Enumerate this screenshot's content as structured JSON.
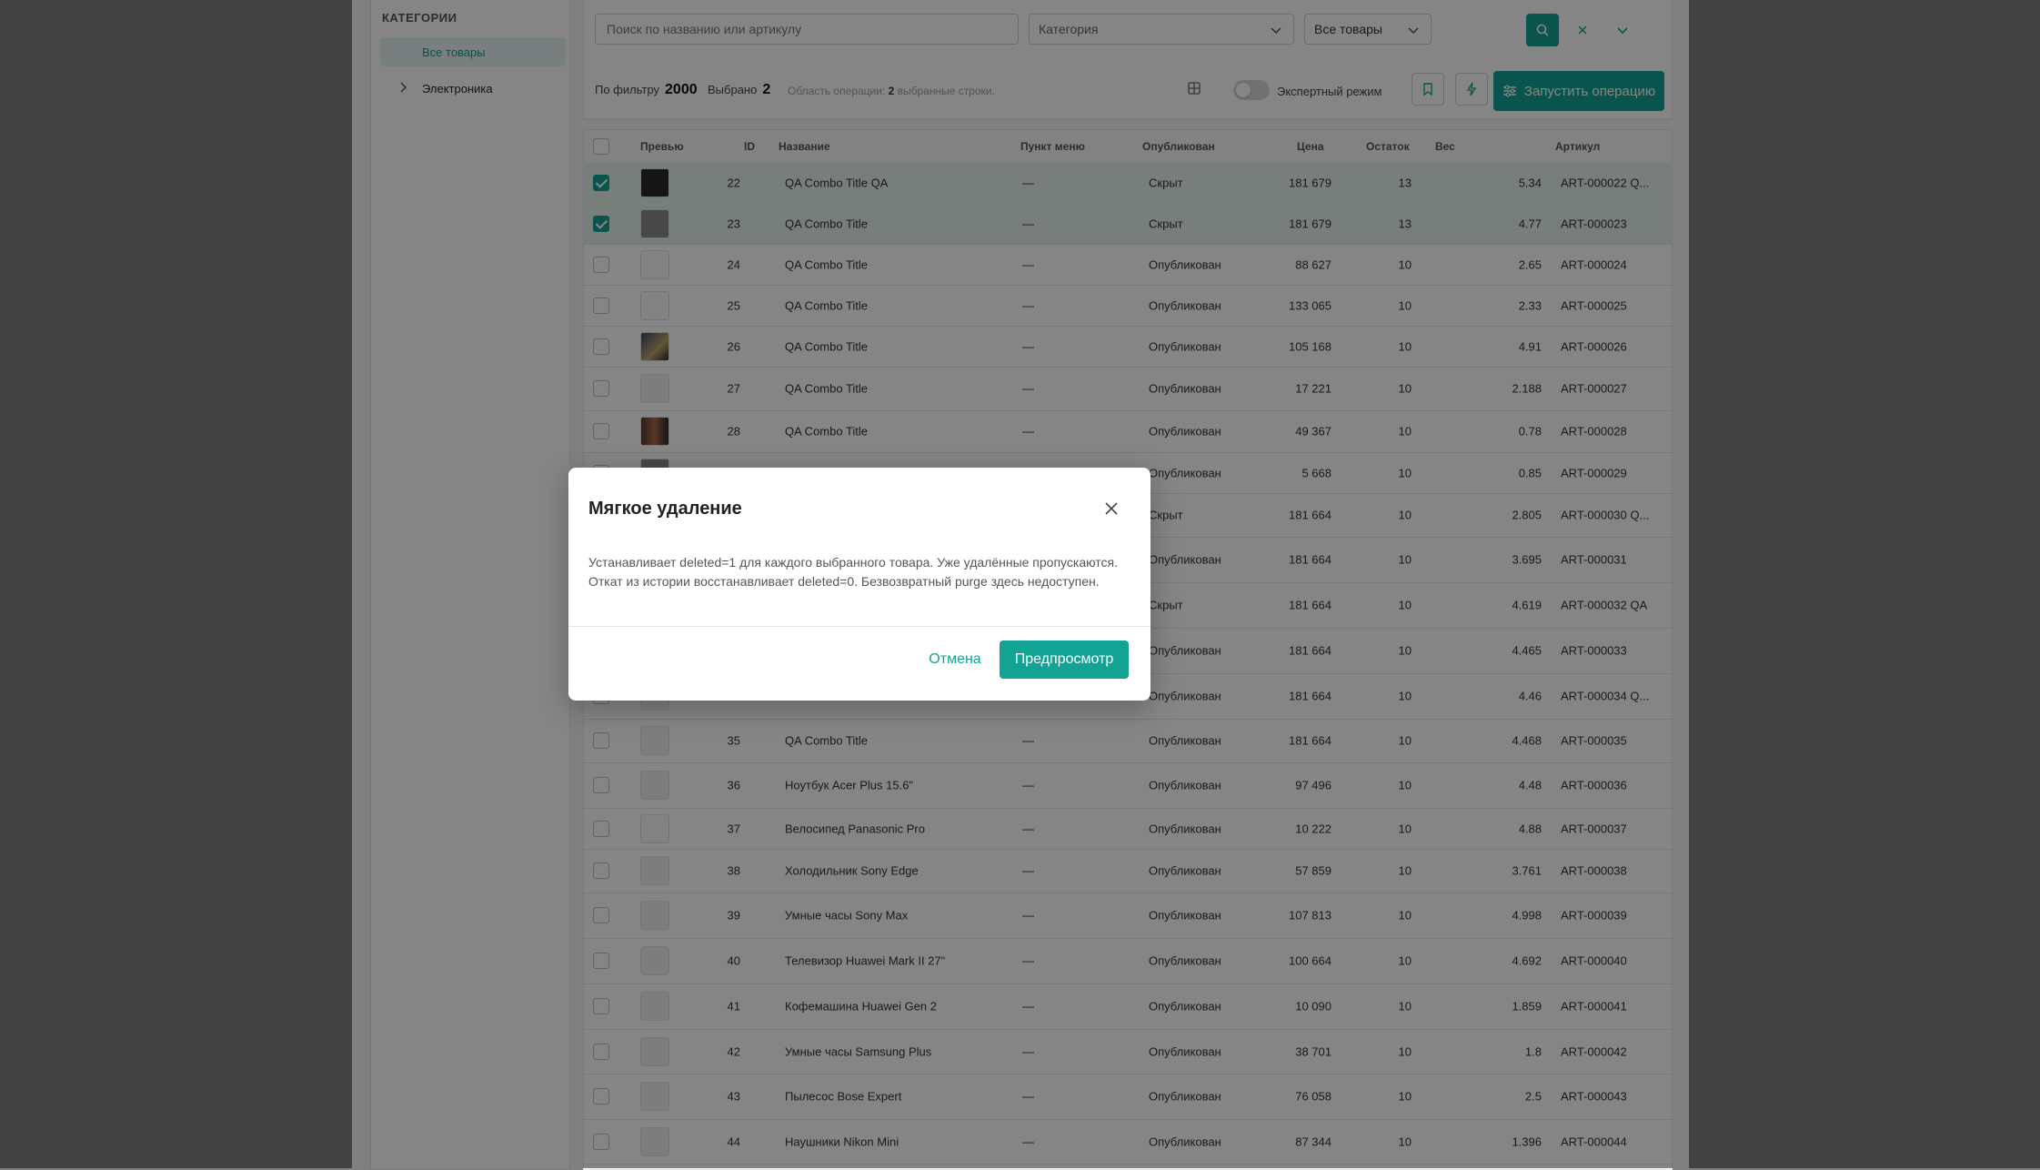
{
  "sidebar": {
    "title": "КАТЕГОРИИ",
    "items": [
      {
        "label": "Все товары"
      },
      {
        "label": "Электроника"
      }
    ]
  },
  "toolbar": {
    "search_placeholder": "Поиск по названию или артикулу",
    "category_label": "Категория",
    "filter_label": "Все товары",
    "by_filter_label": "По фильтру",
    "by_filter_count": "2000",
    "selected_label": "Выбрано",
    "selected_count": "2",
    "scope_prefix": "Область операции:",
    "scope_count": "2",
    "scope_suffix": "выбранные строки.",
    "expert_mode_label": "Экспертный режим",
    "run_label": "Запустить операцию"
  },
  "colors": {
    "accent": "#13a394",
    "selected_row": "#e4f1ee"
  },
  "table": {
    "headers": [
      "Превью",
      "ID",
      "Название",
      "Пункт меню",
      "Опубликован",
      "Цена",
      "Остаток",
      "Вес",
      "Артикул"
    ],
    "rows": [
      {
        "id": "22",
        "name": "QA Combo Title QA",
        "menu": "—",
        "status": "Скрыт",
        "price": "181 679",
        "stock": "13",
        "weight": "5.34",
        "sku": "ART-000022 Q...",
        "checked": true,
        "thumb": "dark"
      },
      {
        "id": "23",
        "name": "QA Combo Title",
        "menu": "—",
        "status": "Скрыт",
        "price": "181 679",
        "stock": "13",
        "weight": "4.77",
        "sku": "ART-000023",
        "checked": true,
        "thumb": "gray"
      },
      {
        "id": "24",
        "name": "QA Combo Title",
        "menu": "—",
        "status": "Опубликован",
        "price": "88 627",
        "stock": "10",
        "weight": "2.65",
        "sku": "ART-000024",
        "checked": false,
        "thumb": "headphone"
      },
      {
        "id": "25",
        "name": "QA Combo Title",
        "menu": "—",
        "status": "Опубликован",
        "price": "133 065",
        "stock": "10",
        "weight": "2.33",
        "sku": "ART-000025",
        "checked": false,
        "thumb": "gamepad"
      },
      {
        "id": "26",
        "name": "QA Combo Title",
        "menu": "—",
        "status": "Опубликован",
        "price": "105 168",
        "stock": "10",
        "weight": "4.91",
        "sku": "ART-000026",
        "checked": false,
        "thumb": "photo"
      },
      {
        "id": "27",
        "name": "QA Combo Title",
        "menu": "—",
        "status": "Опубликован",
        "price": "17 221",
        "stock": "10",
        "weight": "2.188",
        "sku": "ART-000027",
        "checked": false,
        "thumb": "empty"
      },
      {
        "id": "28",
        "name": "QA Combo Title",
        "menu": "—",
        "status": "Опубликован",
        "price": "49 367",
        "stock": "10",
        "weight": "0.78",
        "sku": "ART-000028",
        "checked": false,
        "thumb": "grid"
      },
      {
        "id": "",
        "name": "",
        "menu": "",
        "status": "Опубликован",
        "price": "5 668",
        "stock": "10",
        "weight": "0.85",
        "sku": "ART-000029",
        "checked": false,
        "thumb": "gray"
      },
      {
        "id": "",
        "name": "",
        "menu": "",
        "status": "Скрыт",
        "price": "181 664",
        "stock": "10",
        "weight": "2.805",
        "sku": "ART-000030 Q...",
        "checked": false,
        "thumb": "empty"
      },
      {
        "id": "",
        "name": "",
        "menu": "",
        "status": "Опубликован",
        "price": "181 664",
        "stock": "10",
        "weight": "3.695",
        "sku": "ART-000031",
        "checked": false,
        "thumb": "empty"
      },
      {
        "id": "",
        "name": "",
        "menu": "",
        "status": "Скрыт",
        "price": "181 664",
        "stock": "10",
        "weight": "4.619",
        "sku": "ART-000032 QA",
        "checked": false,
        "thumb": "empty"
      },
      {
        "id": "",
        "name": "",
        "menu": "",
        "status": "Опубликован",
        "price": "181 664",
        "stock": "10",
        "weight": "4.465",
        "sku": "ART-000033",
        "checked": false,
        "thumb": "empty"
      },
      {
        "id": "",
        "name": "",
        "menu": "",
        "status": "Опубликован",
        "price": "181 664",
        "stock": "10",
        "weight": "4.46",
        "sku": "ART-000034 Q...",
        "checked": false,
        "thumb": "empty"
      },
      {
        "id": "35",
        "name": "QA Combo Title",
        "menu": "—",
        "status": "Опубликован",
        "price": "181 664",
        "stock": "10",
        "weight": "4.468",
        "sku": "ART-000035",
        "checked": false,
        "thumb": "empty"
      },
      {
        "id": "36",
        "name": "Ноутбук Acer Plus 15.6\"",
        "menu": "—",
        "status": "Опубликован",
        "price": "97 496",
        "stock": "10",
        "weight": "4.48",
        "sku": "ART-000036",
        "checked": false,
        "thumb": "empty"
      },
      {
        "id": "37",
        "name": "Велосипед Panasonic Pro",
        "menu": "—",
        "status": "Опубликован",
        "price": "10 222",
        "stock": "10",
        "weight": "4.88",
        "sku": "ART-000037",
        "checked": false,
        "thumb": "headphone"
      },
      {
        "id": "38",
        "name": "Холодильник Sony Edge",
        "menu": "—",
        "status": "Опубликован",
        "price": "57 859",
        "stock": "10",
        "weight": "3.761",
        "sku": "ART-000038",
        "checked": false,
        "thumb": "empty"
      },
      {
        "id": "39",
        "name": "Умные часы Sony Max",
        "menu": "—",
        "status": "Опубликован",
        "price": "107 813",
        "stock": "10",
        "weight": "4.998",
        "sku": "ART-000039",
        "checked": false,
        "thumb": "empty"
      },
      {
        "id": "40",
        "name": "Телевизор Huawei Mark II 27\"",
        "menu": "—",
        "status": "Опубликован",
        "price": "100 664",
        "stock": "10",
        "weight": "4.692",
        "sku": "ART-000040",
        "checked": false,
        "thumb": "empty"
      },
      {
        "id": "41",
        "name": "Кофемашина Huawei Gen 2",
        "menu": "—",
        "status": "Опубликован",
        "price": "10 090",
        "stock": "10",
        "weight": "1.859",
        "sku": "ART-000041",
        "checked": false,
        "thumb": "empty"
      },
      {
        "id": "42",
        "name": "Умные часы Samsung Plus",
        "menu": "—",
        "status": "Опубликован",
        "price": "38 701",
        "stock": "10",
        "weight": "1.8",
        "sku": "ART-000042",
        "checked": false,
        "thumb": "empty"
      },
      {
        "id": "43",
        "name": "Пылесос Bose Expert",
        "menu": "—",
        "status": "Опубликован",
        "price": "76 058",
        "stock": "10",
        "weight": "2.5",
        "sku": "ART-000043",
        "checked": false,
        "thumb": "empty"
      },
      {
        "id": "44",
        "name": "Наушники Nikon Mini",
        "menu": "—",
        "status": "Опубликован",
        "price": "87 344",
        "stock": "10",
        "weight": "1.396",
        "sku": "ART-000044",
        "checked": false,
        "thumb": "empty"
      }
    ]
  },
  "modal": {
    "title": "Мягкое удаление",
    "body": "Устанавливает deleted=1 для каждого выбранного товара. Уже удалённые пропускаются. Откат из истории восстанавливает deleted=0. Безвозвратный purge здесь недоступен.",
    "cancel_label": "Отмена",
    "preview_label": "Предпросмотр"
  }
}
